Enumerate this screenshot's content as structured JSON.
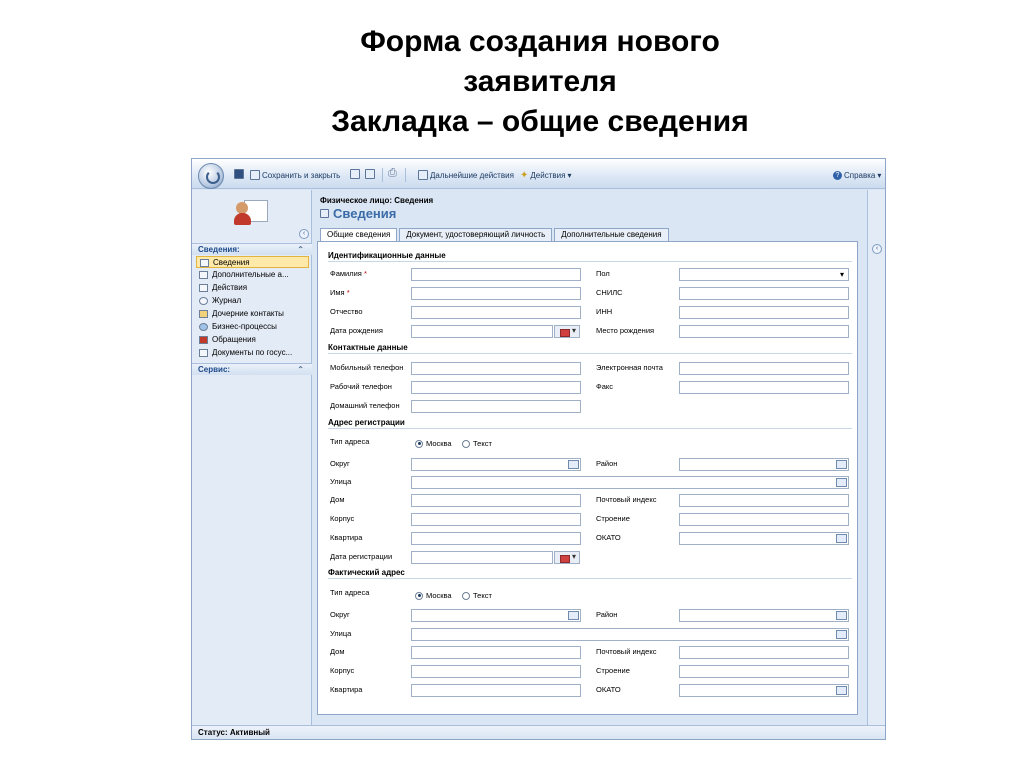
{
  "slide": {
    "title_line1": "Форма создания нового",
    "title_line2": "заявителя",
    "title_line3": "Закладка – общие сведения"
  },
  "toolbar": {
    "save_close": "Сохранить и закрыть",
    "further_actions": "Дальнейшие действия",
    "actions": "Действия",
    "help": "Справка"
  },
  "sidebar": {
    "section_info": "Сведения:",
    "items": [
      {
        "label": "Сведения",
        "active": true
      },
      {
        "label": "Дополнительные а..."
      },
      {
        "label": "Действия"
      },
      {
        "label": "Журнал"
      },
      {
        "label": "Дочерние контакты"
      },
      {
        "label": "Бизнес-процессы"
      },
      {
        "label": "Обращения"
      },
      {
        "label": "Документы по госус..."
      }
    ],
    "section_service": "Сервис:"
  },
  "header": {
    "entity": "Физическое лицо: Сведения",
    "title": "Сведения"
  },
  "tabs": [
    {
      "label": "Общие сведения",
      "active": true
    },
    {
      "label": "Документ, удостоверяющий личность"
    },
    {
      "label": "Дополнительные сведения"
    }
  ],
  "form": {
    "sec_ident": "Идентификационные данные",
    "surname": "Фамилия",
    "name": "Имя",
    "patronymic": "Отчество",
    "birth_date": "Дата рождения",
    "sex": "Пол",
    "snils": "СНИЛС",
    "inn": "ИНН",
    "birth_place": "Место рождения",
    "req_mark": "*",
    "sec_contact": "Контактные данные",
    "mobile": "Мобильный телефон",
    "work_phone": "Рабочий телефон",
    "home_phone": "Домашний телефон",
    "email": "Электронная почта",
    "fax": "Факс",
    "sec_reg": "Адрес регистрации",
    "addr_type": "Тип адреса",
    "opt_moscow": "Москва",
    "opt_text": "Текст",
    "okrug": "Округ",
    "street": "Улица",
    "house": "Дом",
    "korpus": "Корпус",
    "apartment": "Квартира",
    "reg_date": "Дата регистрации",
    "district": "Район",
    "postcode": "Почтовый индекс",
    "building": "Строение",
    "okato": "ОКАТО",
    "sec_actual": "Фактический адрес"
  },
  "status": {
    "text": "Статус: Активный"
  }
}
